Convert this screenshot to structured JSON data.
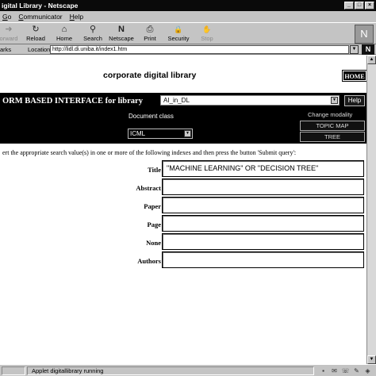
{
  "window": {
    "title": "igital Library - Netscape"
  },
  "menubar": [
    {
      "prefix": "",
      "acc": "G",
      "rest": "o"
    },
    {
      "prefix": "",
      "acc": "C",
      "rest": "ommunicator"
    },
    {
      "prefix": "",
      "acc": "H",
      "rest": "elp"
    }
  ],
  "toolbar": [
    {
      "label": "orward",
      "icon": "arrow-forward",
      "glyph": "➜",
      "enabled": false
    },
    {
      "label": "Reload",
      "icon": "reload",
      "glyph": "↻",
      "enabled": true
    },
    {
      "label": "Home",
      "icon": "home",
      "glyph": "⌂",
      "enabled": true
    },
    {
      "label": "Search",
      "icon": "search",
      "glyph": "⚲",
      "enabled": true
    },
    {
      "label": "Netscape",
      "icon": "netscape-logo",
      "glyph": "N",
      "enabled": true
    },
    {
      "label": "Print",
      "icon": "printer",
      "glyph": "⎙",
      "enabled": true
    },
    {
      "label": "Security",
      "icon": "lock",
      "glyph": "🔒",
      "enabled": true
    },
    {
      "label": "Stop",
      "icon": "stop",
      "glyph": "✋",
      "enabled": false
    }
  ],
  "location": {
    "bookmarks_label": "arks",
    "label": "Location:",
    "url": "http://lidl.di.uniba.it/index1.htm"
  },
  "page": {
    "banner_title": "corporate digital library",
    "home_button": "HOME",
    "form_title": "ORM BASED INTERFACE for library",
    "library_select": "AI_in_DL",
    "help_button": "Help",
    "document_class_label": "Document class",
    "document_class_select": "ICML",
    "change_modality_label": "Change modality",
    "topic_map_button": "TOPIC MAP",
    "tree_button": "TREE",
    "instructions": "ert the appropriate search value(s) in one or more of the following indexes and then press the button 'Submit query':",
    "fields": [
      {
        "label": "Title",
        "value": "\"MACHINE LEARNING\" OR \"DECISION TREE\""
      },
      {
        "label": "Abstract",
        "value": ""
      },
      {
        "label": "Paper",
        "value": ""
      },
      {
        "label": "Page",
        "value": ""
      },
      {
        "label": "None",
        "value": ""
      },
      {
        "label": "Authors",
        "value": ""
      }
    ]
  },
  "statusbar": {
    "text": "Applet digitallibrary running"
  }
}
